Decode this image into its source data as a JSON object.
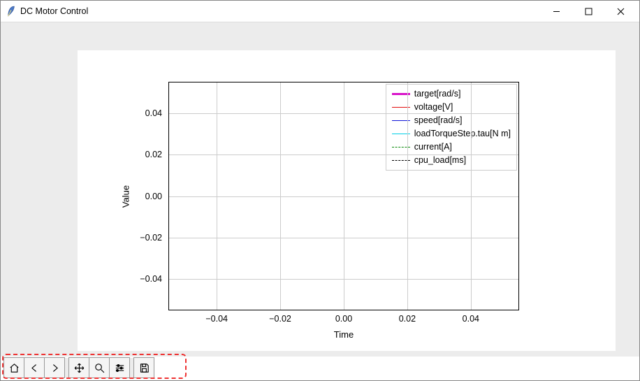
{
  "window": {
    "title": "DC Motor Control"
  },
  "chart_data": {
    "type": "line",
    "title": "",
    "xlabel": "Time",
    "ylabel": "Value",
    "xlim": [
      -0.055,
      0.055
    ],
    "ylim": [
      -0.055,
      0.055
    ],
    "xticks": [
      -0.04,
      -0.02,
      0.0,
      0.02,
      0.04
    ],
    "yticks": [
      -0.04,
      -0.02,
      0.0,
      0.02,
      0.04
    ],
    "xtick_labels": [
      "−0.04",
      "−0.02",
      "0.00",
      "0.02",
      "0.04"
    ],
    "ytick_labels": [
      "−0.04",
      "−0.02",
      "0.00",
      "0.02",
      "0.04"
    ],
    "series": [
      {
        "name": "target[rad/s]",
        "color": "#d813c9",
        "style": "solid",
        "width": 3,
        "x": [],
        "y": []
      },
      {
        "name": "voltage[V]",
        "color": "#e30f0f",
        "style": "solid",
        "width": 1.5,
        "x": [],
        "y": []
      },
      {
        "name": "speed[rad/s]",
        "color": "#1116d8",
        "style": "solid",
        "width": 1.5,
        "x": [],
        "y": []
      },
      {
        "name": "loadTorqueStep.tau[N m]",
        "color": "#00d0e6",
        "style": "solid",
        "width": 1.5,
        "x": [],
        "y": []
      },
      {
        "name": "current[A]",
        "color": "#0a8a0a",
        "style": "dashed",
        "width": 1.5,
        "x": [],
        "y": []
      },
      {
        "name": "cpu_load[ms]",
        "color": "#000000",
        "style": "dashed",
        "width": 1.5,
        "x": [],
        "y": []
      }
    ]
  },
  "toolbar": {
    "home": "Home",
    "back": "Back",
    "forward": "Forward",
    "pan": "Pan",
    "zoom": "Zoom",
    "config": "Configure subplots",
    "save": "Save"
  }
}
